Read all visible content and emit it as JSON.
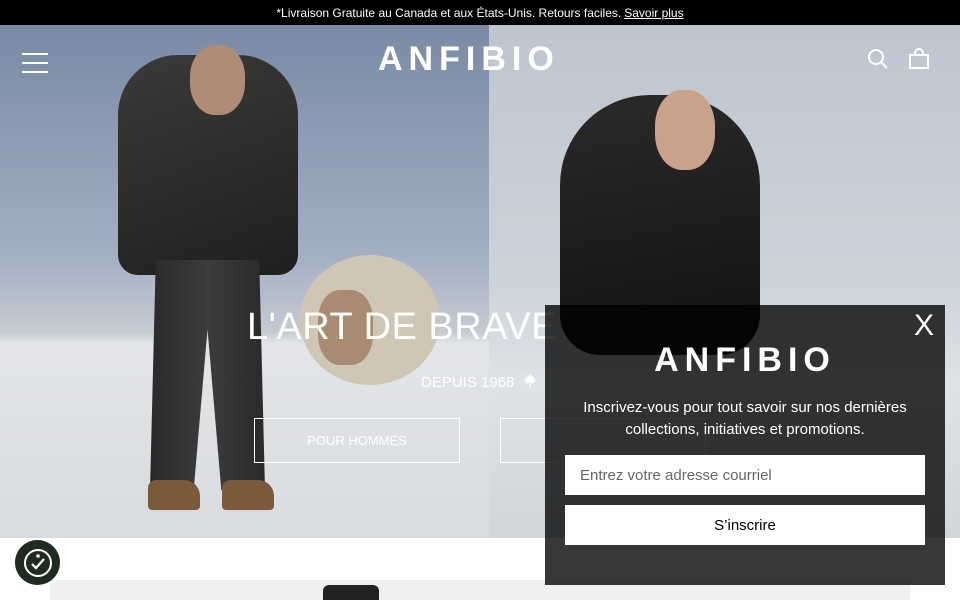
{
  "announcement": {
    "text": "*Livraison Gratuite au Canada et aux États-Unis. Retours faciles.",
    "link": "Savoir plus"
  },
  "header": {
    "logo": "ANFIBIO",
    "icons": [
      "hamburger-menu-icon",
      "search-icon",
      "cart-icon"
    ]
  },
  "hero": {
    "title": "L'ART DE BRAVE",
    "subtitle": "DEPUIS 1968",
    "subtitle_icon": "maple-leaf-icon",
    "buttons": [
      {
        "label": "POUR HOMMES"
      },
      {
        "label": ""
      }
    ]
  },
  "popup": {
    "logo": "ANFIBIO",
    "close_label": "X",
    "text": "Inscrivez-vous pour tout savoir sur nos dernières collections, initiatives et promotions.",
    "email_placeholder": "Entrez votre adresse courriel",
    "submit_label": "S’inscrire"
  },
  "accessibility": {
    "icon": "accessibility-icon"
  },
  "colors": {
    "announcement_bg": "#000000",
    "popup_bg": "#000000",
    "text": "#ffffff"
  }
}
